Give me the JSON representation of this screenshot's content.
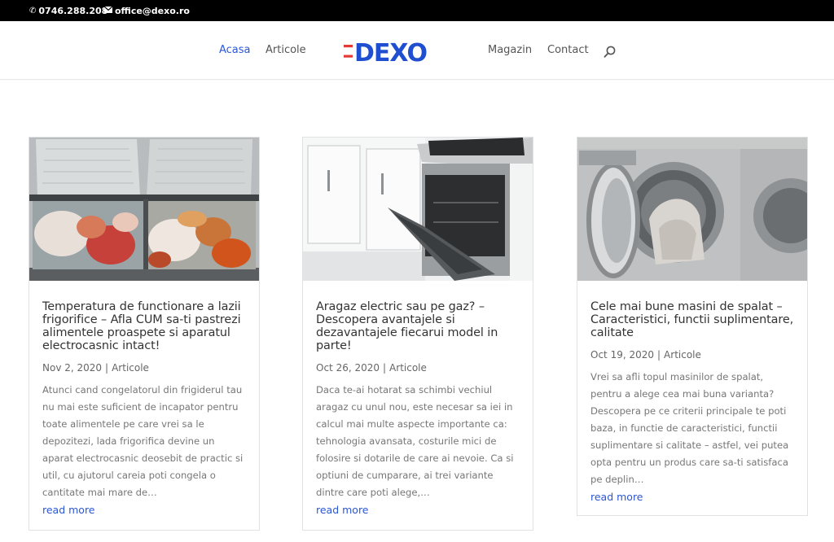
{
  "topbar": {
    "phone": "0746.288.208",
    "email": "office@dexo.ro",
    "phone_icon": "phone-icon",
    "email_icon": "envelope-icon"
  },
  "nav": {
    "items": [
      {
        "label": "Acasa",
        "active": true
      },
      {
        "label": "Articole",
        "active": false
      },
      {
        "label": "Magazin",
        "active": false
      },
      {
        "label": "Contact",
        "active": false
      }
    ],
    "logo_text": "DEXO",
    "search_icon": "search-icon"
  },
  "colors": {
    "accent": "#2b56d6",
    "logo_red": "#e53935",
    "logo_blue": "#1f4fd0",
    "topbar": "#000000"
  },
  "posts": [
    {
      "title": "Temperatura de functionare a lazii frigorifice – Afla CUM sa-ti pastrezi alimentele proaspete si aparatul electrocasnic intact!",
      "date": "Nov 2, 2020",
      "category": "Articole",
      "excerpt": "Atunci cand congelatorul din frigiderul tau nu mai este suficient de incapator pentru toate alimentele pe care vrei sa le depozitezi, lada frigorifica devine un aparat electrocasnic deosebit de practic si util, cu ajutorul careia poti congela o cantitate mai mare de…",
      "read_more": "read more",
      "image": "chest-freezer-photo"
    },
    {
      "title": "Aragaz electric sau pe gaz? – Descopera avantajele si dezavantajele fiecarui model in parte!",
      "date": "Oct 26, 2020",
      "category": "Articole",
      "excerpt": "Daca te-ai hotarat sa schimbi vechiul aragaz cu unul nou, este necesar sa iei in calcul mai multe aspecte importante ca: tehnologia avansata, costurile mici de folosire si dotarile de care ai nevoie. Ca si optiuni de cumparare, ai trei variante dintre care poti alege,…",
      "read_more": "read more",
      "image": "kitchen-oven-photo"
    },
    {
      "title": "Cele mai bune masini de spalat – Caracteristici, functii suplimentare, calitate",
      "date": "Oct 19, 2020",
      "category": "Articole",
      "excerpt": "Vrei sa afli topul masinilor de spalat, pentru a alege cea mai buna varianta? Descopera pe ce criterii principale te poti baza, in functie de caracteristici, functii suplimentare si calitate – astfel, vei putea opta pentru un produs care sa-ti satisfaca pe deplin…",
      "read_more": "read more",
      "image": "washing-machine-photo"
    }
  ]
}
